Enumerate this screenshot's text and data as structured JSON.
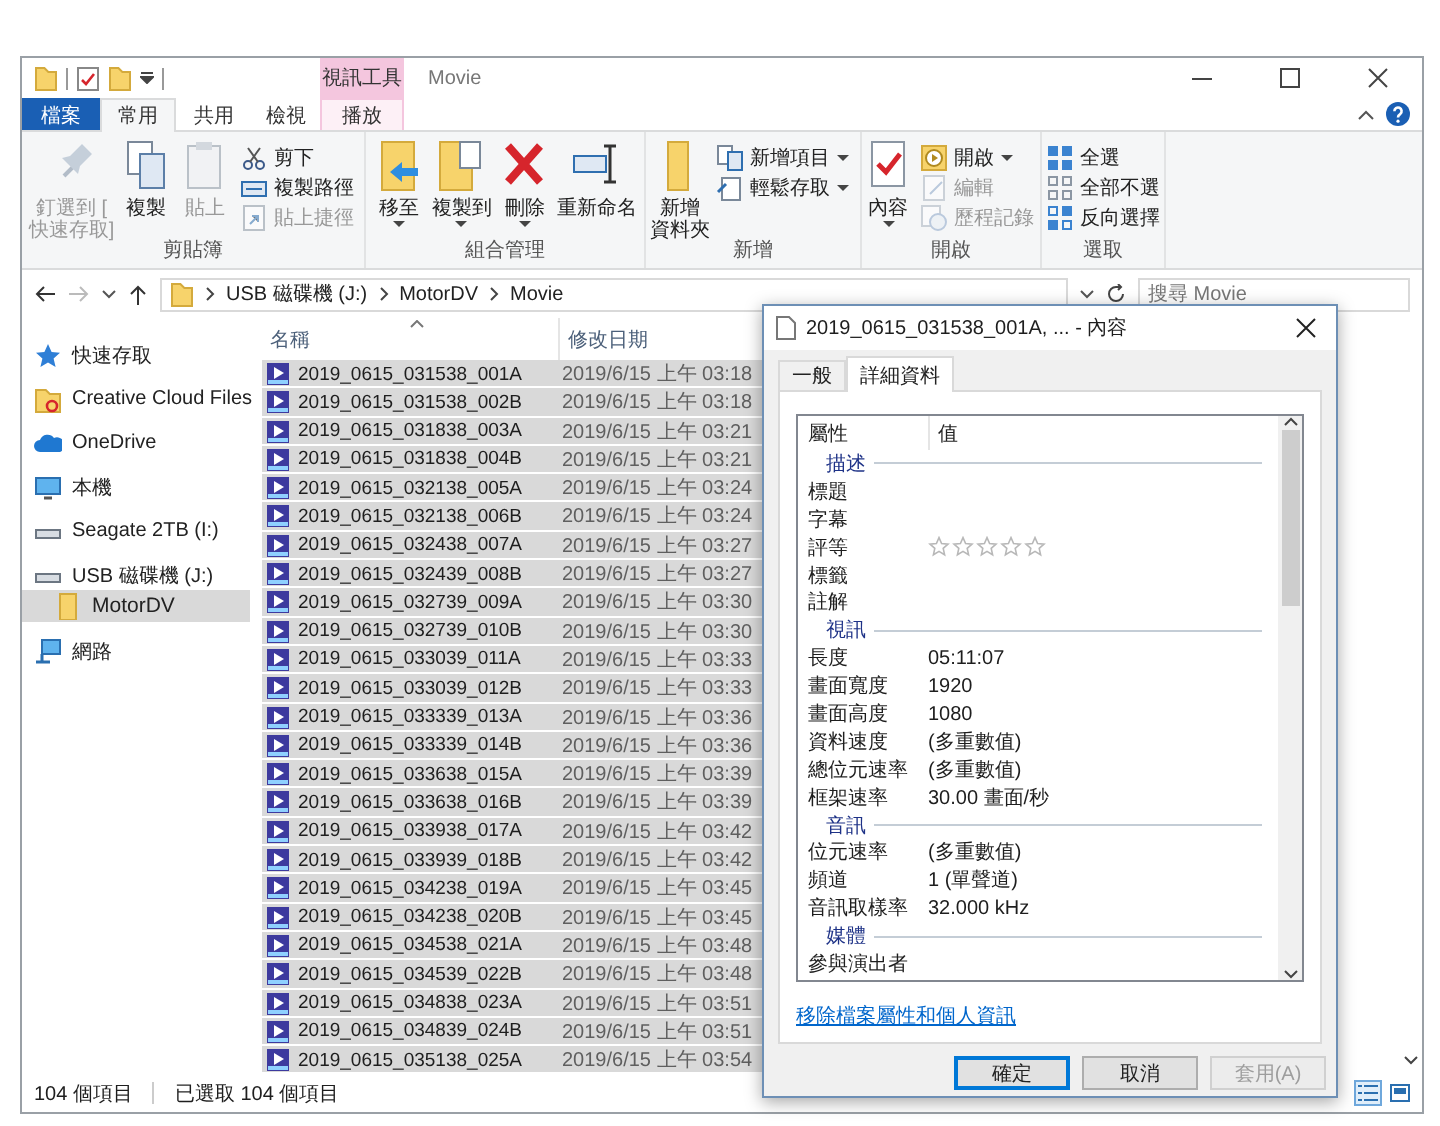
{
  "title_bar": {
    "context_label": "視訊工具",
    "title": "Movie"
  },
  "ribbon_tabs": [
    {
      "label": "檔案",
      "kind": "file",
      "selected": false
    },
    {
      "label": "常用",
      "kind": "tab",
      "selected": true
    },
    {
      "label": "共用",
      "kind": "tab",
      "selected": false
    },
    {
      "label": "檢視",
      "kind": "tab",
      "selected": false
    },
    {
      "label": "播放",
      "kind": "context",
      "selected": false
    }
  ],
  "ribbon_groups": [
    {
      "label": "剪貼簿",
      "items": [
        {
          "kind": "large",
          "lines": [
            "釘選到 [",
            "快速存取]"
          ],
          "disabled": true,
          "dropdown": false
        },
        {
          "kind": "large",
          "lines": [
            "複製"
          ],
          "disabled": false,
          "dropdown": false
        },
        {
          "kind": "large",
          "lines": [
            "貼上"
          ],
          "disabled": true,
          "dropdown": false
        },
        {
          "kind": "stack",
          "items": [
            {
              "label": "剪下",
              "disabled": false,
              "dropdown": false
            },
            {
              "label": "複製路徑",
              "disabled": false,
              "dropdown": false
            },
            {
              "label": "貼上捷徑",
              "disabled": true,
              "dropdown": false
            }
          ]
        }
      ]
    },
    {
      "label": "組合管理",
      "items": [
        {
          "kind": "large",
          "lines": [
            "移至"
          ],
          "disabled": false,
          "dropdown": true
        },
        {
          "kind": "large",
          "lines": [
            "複製到"
          ],
          "disabled": false,
          "dropdown": true
        },
        {
          "kind": "large",
          "lines": [
            "刪除"
          ],
          "disabled": false,
          "dropdown": true
        },
        {
          "kind": "large",
          "lines": [
            "重新命名"
          ],
          "disabled": false,
          "dropdown": false
        }
      ]
    },
    {
      "label": "新增",
      "items": [
        {
          "kind": "large",
          "lines": [
            "新增",
            "資料夾"
          ],
          "disabled": false,
          "dropdown": false
        },
        {
          "kind": "stack",
          "items": [
            {
              "label": "新增項目",
              "disabled": false,
              "dropdown": true
            },
            {
              "label": "輕鬆存取",
              "disabled": false,
              "dropdown": true
            }
          ]
        }
      ]
    },
    {
      "label": "開啟",
      "items": [
        {
          "kind": "large",
          "lines": [
            "內容"
          ],
          "disabled": false,
          "dropdown": true
        },
        {
          "kind": "stack",
          "items": [
            {
              "label": "開啟",
              "disabled": false,
              "dropdown": true
            },
            {
              "label": "編輯",
              "disabled": true,
              "dropdown": false
            },
            {
              "label": "歷程記錄",
              "disabled": true,
              "dropdown": false
            }
          ]
        }
      ]
    },
    {
      "label": "選取",
      "items": [
        {
          "kind": "stack",
          "items": [
            {
              "label": "全選",
              "disabled": false,
              "dropdown": false
            },
            {
              "label": "全部不選",
              "disabled": false,
              "dropdown": false
            },
            {
              "label": "反向選擇",
              "disabled": false,
              "dropdown": false
            }
          ]
        }
      ]
    }
  ],
  "address": {
    "path": [
      "USB 磁碟機 (J:)",
      "MotorDV",
      "Movie"
    ]
  },
  "search": {
    "placeholder": "搜尋 Movie"
  },
  "nav_pane": [
    {
      "label": "快速存取",
      "selected": false
    },
    {
      "label": "Creative Cloud Files",
      "selected": false
    },
    {
      "label": "OneDrive",
      "selected": false
    },
    {
      "label": "本機",
      "selected": false
    },
    {
      "label": "Seagate 2TB (I:)",
      "selected": false
    },
    {
      "label": "USB 磁碟機 (J:)",
      "selected": false,
      "children": [
        {
          "label": "MotorDV",
          "selected": true
        }
      ]
    },
    {
      "label": "網路",
      "selected": false
    }
  ],
  "file_list": {
    "columns": [
      "名稱",
      "修改日期"
    ],
    "rows": [
      {
        "name": "2019_0615_031538_001A",
        "modified": "2019/6/15 上午 03:18",
        "selected": true
      },
      {
        "name": "2019_0615_031538_002B",
        "modified": "2019/6/15 上午 03:18",
        "selected": true
      },
      {
        "name": "2019_0615_031838_003A",
        "modified": "2019/6/15 上午 03:21",
        "selected": true
      },
      {
        "name": "2019_0615_031838_004B",
        "modified": "2019/6/15 上午 03:21",
        "selected": true
      },
      {
        "name": "2019_0615_032138_005A",
        "modified": "2019/6/15 上午 03:24",
        "selected": true
      },
      {
        "name": "2019_0615_032138_006B",
        "modified": "2019/6/15 上午 03:24",
        "selected": true
      },
      {
        "name": "2019_0615_032438_007A",
        "modified": "2019/6/15 上午 03:27",
        "selected": true
      },
      {
        "name": "2019_0615_032439_008B",
        "modified": "2019/6/15 上午 03:27",
        "selected": true
      },
      {
        "name": "2019_0615_032739_009A",
        "modified": "2019/6/15 上午 03:30",
        "selected": true
      },
      {
        "name": "2019_0615_032739_010B",
        "modified": "2019/6/15 上午 03:30",
        "selected": true
      },
      {
        "name": "2019_0615_033039_011A",
        "modified": "2019/6/15 上午 03:33",
        "selected": true
      },
      {
        "name": "2019_0615_033039_012B",
        "modified": "2019/6/15 上午 03:33",
        "selected": true
      },
      {
        "name": "2019_0615_033339_013A",
        "modified": "2019/6/15 上午 03:36",
        "selected": true
      },
      {
        "name": "2019_0615_033339_014B",
        "modified": "2019/6/15 上午 03:36",
        "selected": true
      },
      {
        "name": "2019_0615_033638_015A",
        "modified": "2019/6/15 上午 03:39",
        "selected": true
      },
      {
        "name": "2019_0615_033638_016B",
        "modified": "2019/6/15 上午 03:39",
        "selected": true
      },
      {
        "name": "2019_0615_033938_017A",
        "modified": "2019/6/15 上午 03:42",
        "selected": true
      },
      {
        "name": "2019_0615_033939_018B",
        "modified": "2019/6/15 上午 03:42",
        "selected": true
      },
      {
        "name": "2019_0615_034238_019A",
        "modified": "2019/6/15 上午 03:45",
        "selected": true
      },
      {
        "name": "2019_0615_034238_020B",
        "modified": "2019/6/15 上午 03:45",
        "selected": true
      },
      {
        "name": "2019_0615_034538_021A",
        "modified": "2019/6/15 上午 03:48",
        "selected": true
      },
      {
        "name": "2019_0615_034539_022B",
        "modified": "2019/6/15 上午 03:48",
        "selected": true
      },
      {
        "name": "2019_0615_034838_023A",
        "modified": "2019/6/15 上午 03:51",
        "selected": true
      },
      {
        "name": "2019_0615_034839_024B",
        "modified": "2019/6/15 上午 03:51",
        "selected": true
      },
      {
        "name": "2019_0615_035138_025A",
        "modified": "2019/6/15 上午 03:54",
        "selected": true
      }
    ]
  },
  "status_bar": {
    "item_count": "104 個項目",
    "selection": "已選取 104 個項目"
  },
  "properties_dialog": {
    "title": "2019_0615_031538_001A, ... - 內容",
    "tabs": [
      {
        "label": "一般",
        "selected": false
      },
      {
        "label": "詳細資料",
        "selected": true
      }
    ],
    "columns": [
      "屬性",
      "值"
    ],
    "rows": [
      {
        "kind": "group",
        "label": "描述"
      },
      {
        "kind": "property",
        "name": "標題"
      },
      {
        "kind": "property",
        "name": "字幕"
      },
      {
        "kind": "rating",
        "name": "評等",
        "stars": 0
      },
      {
        "kind": "property",
        "name": "標籤"
      },
      {
        "kind": "property",
        "name": "註解"
      },
      {
        "kind": "group",
        "label": "視訊"
      },
      {
        "kind": "property",
        "name": "長度",
        "value": "05:11:07"
      },
      {
        "kind": "property",
        "name": "畫面寬度",
        "value": "1920"
      },
      {
        "kind": "property",
        "name": "畫面高度",
        "value": "1080"
      },
      {
        "kind": "property",
        "name": "資料速度",
        "value": "(多重數值)"
      },
      {
        "kind": "property",
        "name": "總位元速率",
        "value": "(多重數值)"
      },
      {
        "kind": "property",
        "name": "框架速率",
        "value": "30.00 畫面/秒"
      },
      {
        "kind": "group",
        "label": "音訊"
      },
      {
        "kind": "property",
        "name": "位元速率",
        "value": "(多重數值)"
      },
      {
        "kind": "property",
        "name": "頻道",
        "value": "1 (單聲道)"
      },
      {
        "kind": "property",
        "name": "音訊取樣率",
        "value": "32.000 kHz"
      },
      {
        "kind": "group",
        "label": "媒體"
      },
      {
        "kind": "property",
        "name": "參與演出者"
      }
    ],
    "link": "移除檔案屬性和個人資訊",
    "buttons": [
      {
        "label": "確定",
        "kind": "default",
        "disabled": false
      },
      {
        "label": "取消",
        "kind": "normal",
        "disabled": false
      },
      {
        "label": "套用(A)",
        "kind": "normal",
        "disabled": true
      }
    ]
  }
}
